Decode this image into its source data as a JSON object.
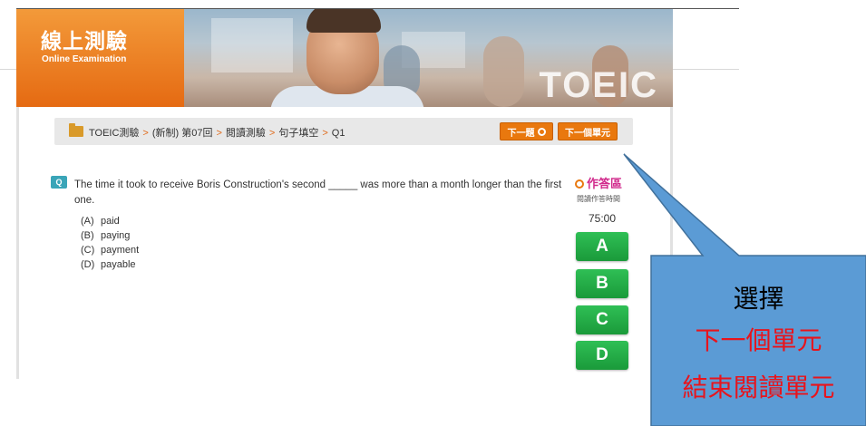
{
  "banner": {
    "title_zh": "線上測驗",
    "title_en": "Online Examination",
    "brand": "TOEIC"
  },
  "breadcrumb": {
    "items": [
      "TOEIC測驗",
      "(新制) 第07回",
      "閱讀測驗",
      "句子填空",
      "Q1"
    ],
    "separator": ">"
  },
  "toolbar": {
    "next_question_label": "下一題",
    "next_unit_label": "下一個單元"
  },
  "question": {
    "badge": "Q",
    "text": "The time it took to receive Boris Construction's second _____ was more than a month longer than the first one.",
    "options": [
      {
        "letter": "(A)",
        "text": "paid"
      },
      {
        "letter": "(B)",
        "text": "paying"
      },
      {
        "letter": "(C)",
        "text": "payment"
      },
      {
        "letter": "(D)",
        "text": "payable"
      }
    ]
  },
  "answer_panel": {
    "title": "作答區",
    "subtitle": "閱讀作答時間",
    "timer": "75:00",
    "buttons": [
      "A",
      "B",
      "C",
      "D"
    ]
  },
  "callout": {
    "line1": "選擇",
    "line2": "下一個單元",
    "line3": "結束閱讀單元"
  },
  "colors": {
    "accent_orange": "#e9780e",
    "answer_green": "#1a9a3a",
    "callout_blue": "#5b9bd5",
    "callout_red": "#e8141c",
    "panel_title_pink": "#d12a8c"
  }
}
